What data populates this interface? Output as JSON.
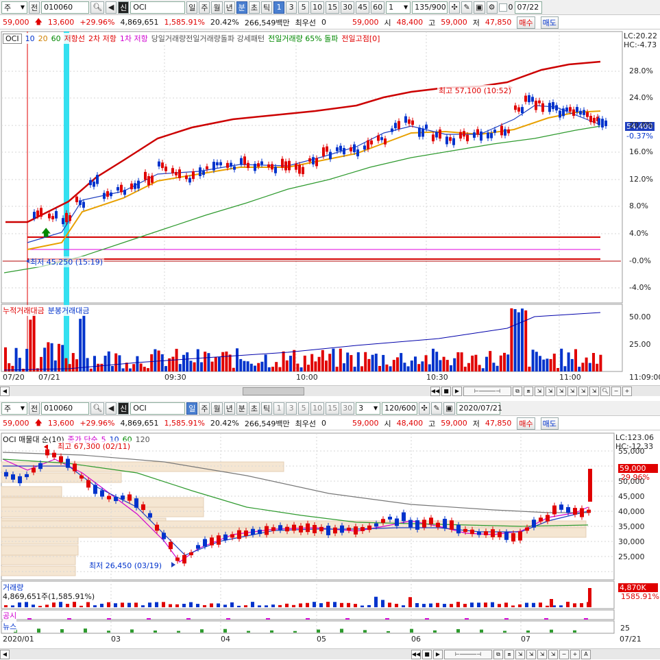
{
  "top": {
    "toolbar": {
      "type_sel": "주",
      "prev_label": "전",
      "code": "010060",
      "name_flag": "신",
      "name": "OCI",
      "periods": [
        "일",
        "주",
        "월",
        "년",
        "분",
        "초",
        "틱"
      ],
      "active_period": "분",
      "intervals": [
        "1",
        "3",
        "5",
        "10",
        "15",
        "30",
        "45",
        "60"
      ],
      "active_interval": "1",
      "interval_value": "1",
      "count": "135/900",
      "check_label": "0",
      "date": "07/22"
    },
    "quote": {
      "price": "59,000",
      "change": "13,600",
      "rate": "+29.96%",
      "volume": "4,869,651",
      "vol_rate": "1,585.91%",
      "turnover": "20.42%",
      "amount": "266,549백만",
      "priority_label": "최우선",
      "priority_value": "0",
      "ask": "59,000",
      "open_label": "시",
      "open": "48,400",
      "high_label": "고",
      "high": "59,000",
      "low_label": "저",
      "low": "47,850",
      "buy_label": "매수",
      "sell_label": "매도"
    },
    "legend": {
      "name": "OCI",
      "ma": [
        "10",
        "20",
        "60"
      ],
      "items": [
        "저항선",
        "2차 저항",
        "1차 저항",
        "당일거래량전일거래량돌파 강세패턴",
        "전일거래량 65% 돌파",
        "전일고점[0]"
      ]
    },
    "lc": "LC:20.22",
    "hc": "HC:-4.73",
    "y_ticks": [
      "28.0%",
      "24.0%",
      "20.0%",
      "16.0%",
      "12.0%",
      "8.0%",
      "4.0%",
      "-0.0%",
      "-4.0%"
    ],
    "price_tag": "54,400",
    "price_tag_rate": "-0.37%",
    "high_note": "최고 57,100 (10:52)",
    "low_note": "최저 45,250 (15:19)",
    "vol_legend": [
      "누적거래대금",
      "분봉거래대금"
    ],
    "vol_ticks": [
      "50.00",
      "25.00"
    ],
    "x_ticks": [
      "07/20",
      "07/21",
      "09:30",
      "10:00",
      "10:30",
      "11:00",
      "11:09:00"
    ]
  },
  "bottom": {
    "toolbar": {
      "type_sel": "주",
      "prev_label": "전",
      "code": "010060",
      "name_flag": "신",
      "name": "OCI",
      "periods": [
        "일",
        "주",
        "월",
        "년",
        "분",
        "초",
        "틱"
      ],
      "active_period": "일",
      "intervals": [
        "1",
        "3",
        "5",
        "10",
        "15",
        "30"
      ],
      "interval_value": "3",
      "count": "120/600",
      "date": "2020/07/21"
    },
    "quote": {
      "price": "59,000",
      "change": "13,600",
      "rate": "+29.96%",
      "volume": "4,869,651",
      "vol_rate": "1,585.91%",
      "turnover": "20.42%",
      "amount": "266,549백만",
      "priority_label": "최우선",
      "priority_value": "0",
      "ask": "59,000",
      "open_label": "시",
      "open": "48,400",
      "high_label": "고",
      "high": "59,000",
      "low_label": "저",
      "low": "47,850",
      "buy_label": "매수",
      "sell_label": "매도"
    },
    "legend": {
      "title": "OCI 매물대 순(10)",
      "ma_label": "종가 단순",
      "ma": [
        "5",
        "10",
        "60",
        "120"
      ]
    },
    "lc": "LC:123.06",
    "hc": "HC:-12.33",
    "y_ticks": [
      "55,000",
      "50,000",
      "45,000",
      "40,000",
      "35,000",
      "30,000",
      "25,000"
    ],
    "price_tag": "59,000",
    "price_tag_rate": "29.96%",
    "high_note": "최고 67,300 (02/11)",
    "low_note": "최저 26,450 (03/19)",
    "vol_title": "거래량",
    "vol_text": "4,869,651주(1,585.91%)",
    "vol_tag": "4,870K",
    "vol_tag_rate": "1585.91%",
    "notice_label": "공시",
    "news_label": "뉴스",
    "news_tick": "25",
    "x_ticks": [
      "2020/01",
      "03",
      "04",
      "05",
      "06",
      "07",
      "07/21"
    ]
  },
  "colors": {
    "up": "#e00000",
    "down": "#0033cc",
    "ma10": "#1f3fbf",
    "ma20": "#e8a000",
    "ma60": "#2e9a2e",
    "resist": "#d40000",
    "highlight": "#33e0f0",
    "volume_profile": "#f5e6d2"
  }
}
